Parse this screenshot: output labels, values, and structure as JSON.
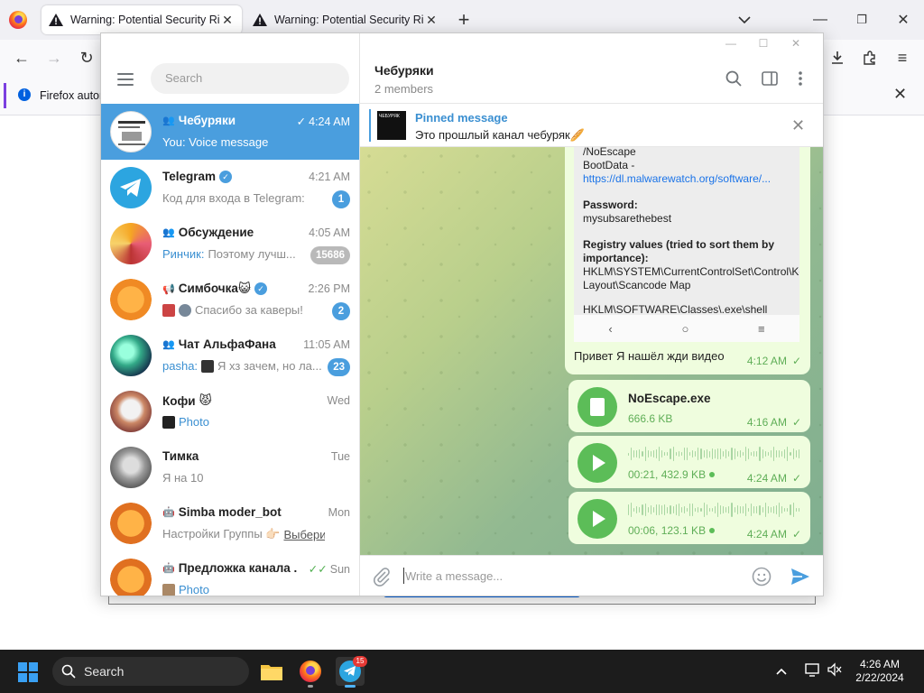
{
  "firefox": {
    "tabs": [
      {
        "title": "Warning: Potential Security Risk Ahead",
        "active": true
      },
      {
        "title": "Warning: Potential Security Risk Ahead",
        "active": false
      }
    ],
    "notification": "Firefox autom"
  },
  "telegram": {
    "search_placeholder": "Search",
    "chats": [
      {
        "name": "Чебуряки",
        "time": "4:24 AM",
        "preview": "You: Voice message",
        "icon": "group-icon",
        "read": true,
        "active": true,
        "avatar": "cheburyaki"
      },
      {
        "name": "Telegram",
        "time": "4:21 AM",
        "preview": "Код для входа в Telegram:",
        "badge": "1",
        "verified": true,
        "avatar": "telegram"
      },
      {
        "name": "Обсуждение",
        "time": "4:05 AM",
        "sender": "Ринчик:",
        "preview": "Поэтому лучш...",
        "badge": "15686",
        "muted": true,
        "icon": "group-icon",
        "avatar": "discussion"
      },
      {
        "name": "Симбочка😺",
        "time": "2:26 PM",
        "preview": "Спасибо за каверы!",
        "badge": "2",
        "icon": "megaphone-icon",
        "verified": true,
        "avatar": "simba"
      },
      {
        "name": "Чат АльфаФана",
        "time": "11:05 AM",
        "sender": "pasha:",
        "preview": "Я хз зачем, но ла...",
        "badge": "23",
        "icon": "group-icon",
        "avatar": "alpha"
      },
      {
        "name": "Кофи",
        "time": "Wed",
        "preview": "Photo",
        "preview_link": true,
        "avatar": "kofi"
      },
      {
        "name": "Тимка",
        "time": "Tue",
        "preview": "Я на 10",
        "avatar": "timka"
      },
      {
        "name": "Simba moder_bot",
        "time": "Mon",
        "preview": "Настройки Группы 👉🏻",
        "link": "Выбери...",
        "icon": "bot-icon",
        "avatar": "simba"
      },
      {
        "name": "Предложка канала ...",
        "time": "Sun",
        "preview": "Photo",
        "preview_link": true,
        "icon": "bot-icon",
        "read": true,
        "avatar": "simba"
      }
    ],
    "chat": {
      "title": "Чебуряки",
      "members": "2 members",
      "pinned_title": "Pinned message",
      "pinned_text": "Это прошлый канал чебуряк🥖",
      "pinned_thumb": "ЧЕБУРЯК",
      "image_lines": {
        "l0": "/NoEscape",
        "l1": "BootData - ",
        "l1_link": "https://dl.malwarewatch.org/software/...",
        "l2": "Password:",
        "l3": "mysubsarethebest",
        "l4": "Registry values (tried to sort them by importance):",
        "l5": "HKLM\\SYSTEM\\CurrentControlSet\\Control\\Keyboard Layout\\Scancode Map",
        "l6": "HKLM\\SOFTWARE\\Classes\\.exe\\shell"
      },
      "image_caption": "Привет Я нашёл жди видео",
      "image_time": "4:12 AM",
      "file_name": "NoEscape.exe",
      "file_size": "666.6 KB",
      "file_time": "4:16 AM",
      "voice": [
        {
          "meta": "00:21, 432.9 KB",
          "time": "4:24 AM"
        },
        {
          "meta": "00:06, 123.1 KB",
          "time": "4:24 AM"
        }
      ],
      "composer_placeholder": "Write a message..."
    }
  },
  "taskbar": {
    "search": "Search",
    "telegram_badge": "15",
    "time": "4:26 AM",
    "date": "2/22/2024"
  },
  "colors": {
    "accent": "#4a9ede",
    "bubble": "#effdde",
    "play": "#5cbd58",
    "taskbar": "#1c1c1c"
  }
}
